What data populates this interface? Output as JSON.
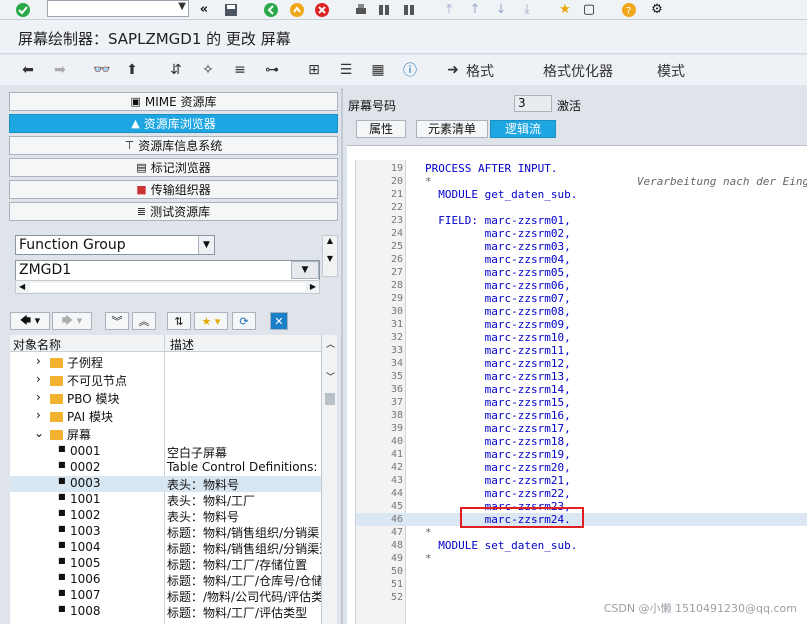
{
  "window": {
    "title": "屏幕绘制器：SAPLZMGD1 的 更改 屏幕"
  },
  "toolbar2": {
    "format_label": "格式",
    "format_optimizer_label": "格式优化器",
    "mode_label": "模式"
  },
  "repo_nav": {
    "buttons": [
      {
        "label": "MIME 资源库",
        "icon": "mime-icon"
      },
      {
        "label": "资源库浏览器",
        "icon": "hierarchy-icon",
        "active": true
      },
      {
        "label": "资源库信息系统",
        "icon": "info-system-icon"
      },
      {
        "label": "标记浏览器",
        "icon": "tag-browser-icon"
      },
      {
        "label": "传输组织器",
        "icon": "transport-icon"
      },
      {
        "label": "测试资源库",
        "icon": "test-repo-icon"
      }
    ]
  },
  "object_selector": {
    "type_value": "Function Group",
    "name_value": "ZMGD1"
  },
  "tree": {
    "col_object": "对象名称",
    "col_desc": "描述",
    "folders": [
      {
        "label": "子例程",
        "expanded": false
      },
      {
        "label": "不可见节点",
        "expanded": false
      },
      {
        "label": "PBO 模块",
        "expanded": false
      },
      {
        "label": "PAI 模块",
        "expanded": false
      },
      {
        "label": "屏幕",
        "expanded": true
      }
    ],
    "screens": [
      {
        "num": "0001",
        "desc": "空白子屏幕"
      },
      {
        "num": "0002",
        "desc": "Table Control Definitions: DC"
      },
      {
        "num": "0003",
        "desc": "表头：物料号",
        "selected": true
      },
      {
        "num": "1001",
        "desc": "表头：物料/工厂"
      },
      {
        "num": "1002",
        "desc": "表头：物料号"
      },
      {
        "num": "1003",
        "desc": "标题：物料/销售组织/分销渠"
      },
      {
        "num": "1004",
        "desc": "标题：物料/销售组织/分销渠道"
      },
      {
        "num": "1005",
        "desc": "标题：物料/工厂/存储位置"
      },
      {
        "num": "1006",
        "desc": "标题：物料/工厂/仓库号/仓储"
      },
      {
        "num": "1007",
        "desc": "标题：/物料/公司代码/评估类"
      },
      {
        "num": "1008",
        "desc": "标题：物料/工厂/评估类型"
      }
    ]
  },
  "screen_header": {
    "screen_no_label": "屏幕号码",
    "screen_no_value": "3",
    "active_label": "激活"
  },
  "tabs": [
    {
      "label": "属性"
    },
    {
      "label": "元素清单"
    },
    {
      "label": "逻辑流",
      "active": true
    }
  ],
  "code": {
    "lines": [
      {
        "n": "19",
        "text": "PROCESS AFTER INPUT."
      },
      {
        "n": "20",
        "text": "*                               Verarbeitung nach der Eingabe",
        "comment": true
      },
      {
        "n": "21",
        "text": "  MODULE get_daten_sub."
      },
      {
        "n": "22",
        "text": ""
      },
      {
        "n": "23",
        "text": "  FIELD: marc-zzsrm01,"
      },
      {
        "n": "24",
        "text": "         marc-zzsrm02,"
      },
      {
        "n": "25",
        "text": "         marc-zzsrm03,"
      },
      {
        "n": "26",
        "text": "         marc-zzsrm04,"
      },
      {
        "n": "27",
        "text": "         marc-zzsrm05,"
      },
      {
        "n": "28",
        "text": "         marc-zzsrm06,"
      },
      {
        "n": "29",
        "text": "         marc-zzsrm07,"
      },
      {
        "n": "30",
        "text": "         marc-zzsrm08,"
      },
      {
        "n": "31",
        "text": "         marc-zzsrm09,"
      },
      {
        "n": "32",
        "text": "         marc-zzsrm10,"
      },
      {
        "n": "33",
        "text": "         marc-zzsrm11,"
      },
      {
        "n": "34",
        "text": "         marc-zzsrm12,"
      },
      {
        "n": "35",
        "text": "         marc-zzsrm13,"
      },
      {
        "n": "36",
        "text": "         marc-zzsrm14,"
      },
      {
        "n": "37",
        "text": "         marc-zzsrm15,"
      },
      {
        "n": "38",
        "text": "         marc-zzsrm16,"
      },
      {
        "n": "39",
        "text": "         marc-zzsrm17,"
      },
      {
        "n": "40",
        "text": "         marc-zzsrm18,"
      },
      {
        "n": "41",
        "text": "         marc-zzsrm19,"
      },
      {
        "n": "42",
        "text": "         marc-zzsrm20,"
      },
      {
        "n": "43",
        "text": "         marc-zzsrm21,"
      },
      {
        "n": "44",
        "text": "         marc-zzsrm22,"
      },
      {
        "n": "45",
        "text": "         marc-zzsrm23,"
      },
      {
        "n": "46",
        "text": "         marc-zzsrm24.",
        "highlight": true
      },
      {
        "n": "47",
        "text": "*",
        "comment": true
      },
      {
        "n": "48",
        "text": "  MODULE set_daten_sub."
      },
      {
        "n": "49",
        "text": "*",
        "comment": true
      },
      {
        "n": "50",
        "text": ""
      },
      {
        "n": "51",
        "text": ""
      },
      {
        "n": "52",
        "text": ""
      }
    ]
  },
  "watermark": "CSDN @小懒 1510491230@qq.com"
}
